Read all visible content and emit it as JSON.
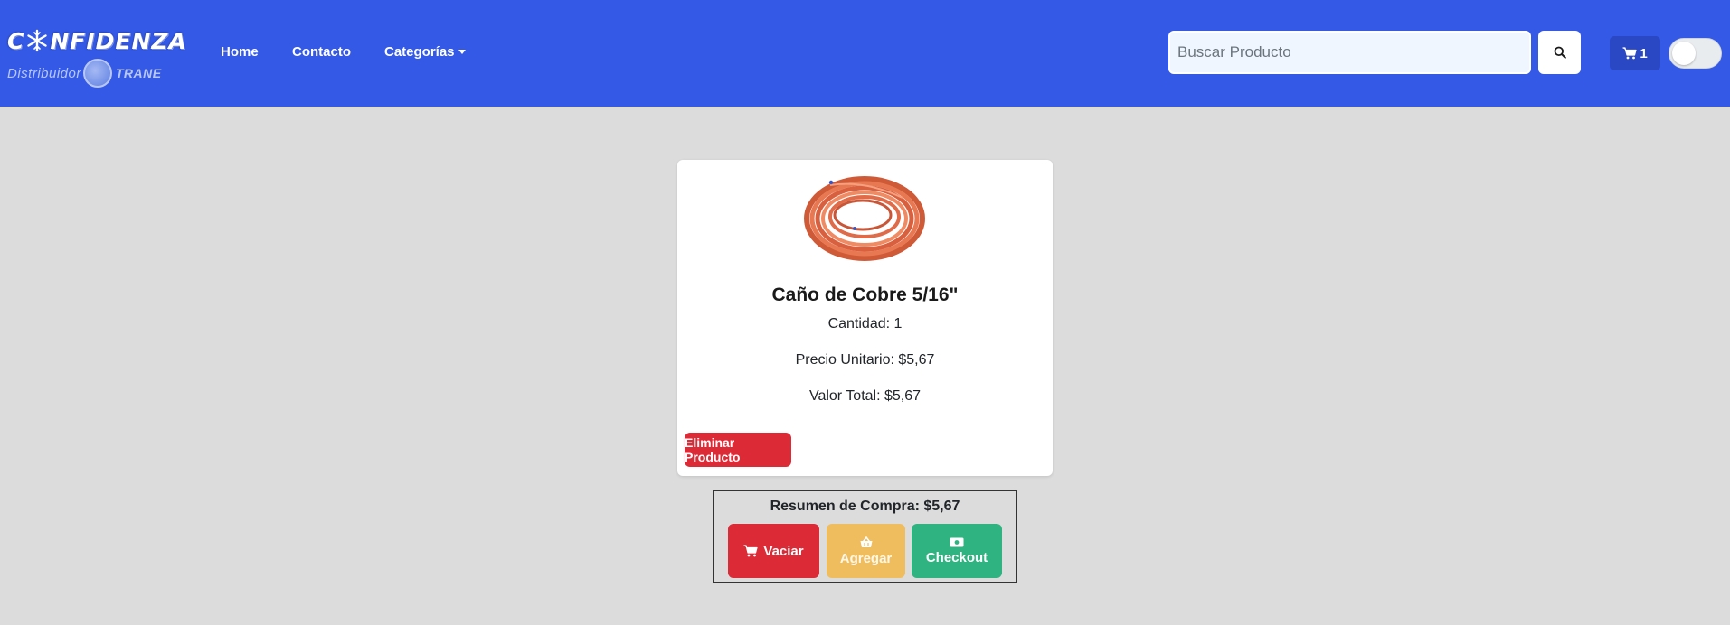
{
  "navbar": {
    "brand": {
      "name_prefix": "C",
      "name_suffix": "NFIDENZA",
      "distributor_label": "Distribuidor",
      "partner": "TRANE"
    },
    "links": [
      {
        "label": "Home"
      },
      {
        "label": "Contacto"
      },
      {
        "label": "Categorías"
      }
    ],
    "search": {
      "placeholder": "Buscar Producto",
      "value": ""
    },
    "cart": {
      "count": "1",
      "icon": "cart-icon"
    },
    "theme_toggle": {
      "checked": false
    }
  },
  "cart_item": {
    "name": "Caño de Cobre 5/16\"",
    "quantity_text": "Cantidad: 1",
    "unit_price_text": "Precio Unitario: $5,67",
    "total_text": "Valor Total: $5,67",
    "remove_label": "Eliminar Producto"
  },
  "summary": {
    "title": "Resumen de Compra: $5,67",
    "buttons": {
      "empty_label": "Vaciar",
      "add_label": "Agregar",
      "checkout_label": "Checkout"
    }
  },
  "colors": {
    "navbar": "#3459e6",
    "background": "#dcdcdc",
    "danger": "#dc2a36",
    "warning": "#f0bd5e",
    "success": "#2fb380"
  }
}
